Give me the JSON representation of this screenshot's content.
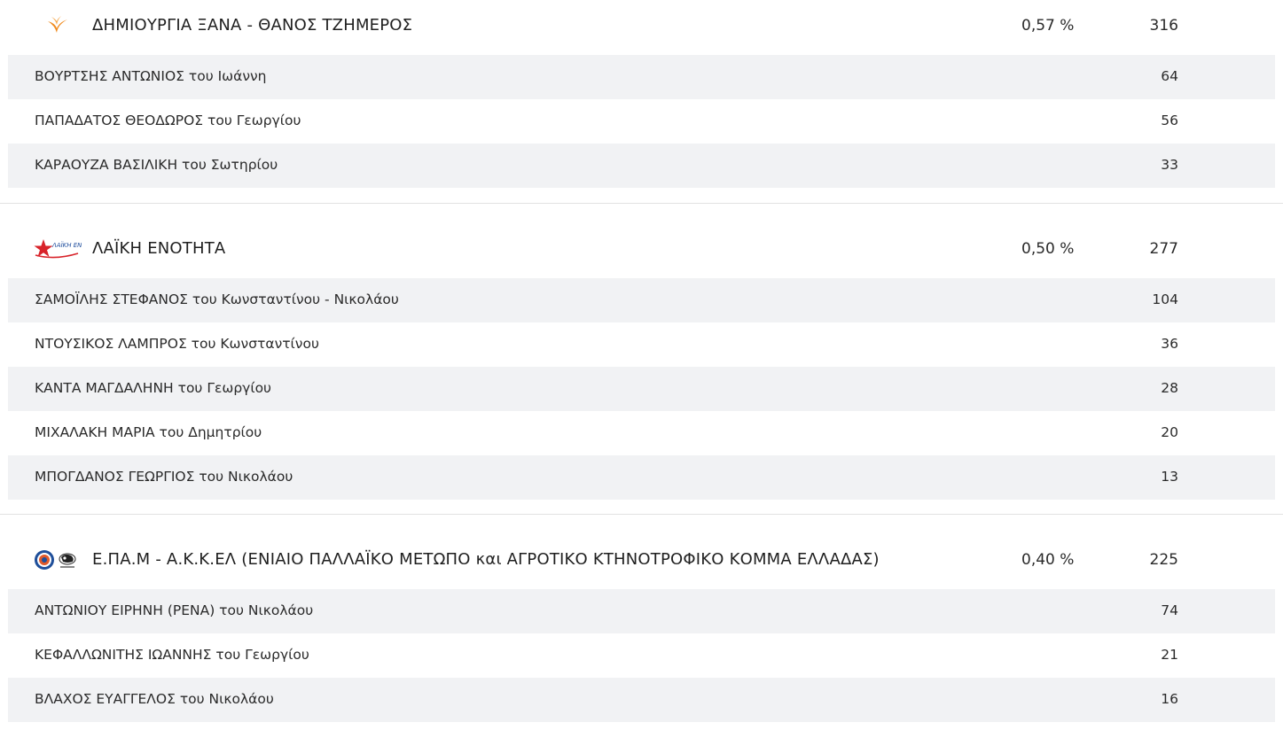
{
  "parties": [
    {
      "logo_icon": "dimiourgia-xana-logo-icon",
      "name": "ΔΗΜΙΟΥΡΓΙΑ ΞΑΝΑ - ΘΑΝΟΣ ΤΖΗΜΕΡΟΣ",
      "percent": "0,57 %",
      "votes": "316",
      "candidates": [
        {
          "name": "ΒΟΥΡΤΣΗΣ ΑΝΤΩΝΙΟΣ του Ιωάννη",
          "votes": "64"
        },
        {
          "name": "ΠΑΠΑΔΑΤΟΣ ΘΕΟΔΩΡΟΣ του Γεωργίου",
          "votes": "56"
        },
        {
          "name": "ΚΑΡΑΟΥΖΑ ΒΑΣΙΛΙΚΗ του Σωτηρίου",
          "votes": "33"
        }
      ]
    },
    {
      "logo_icon": "laiki-enotita-logo-icon",
      "logo_text": "ΛΑΪΚΗ ΕΝΟΤΗΤΑ",
      "name": "ΛΑΪΚΗ ΕΝΟΤΗΤΑ",
      "percent": "0,50 %",
      "votes": "277",
      "candidates": [
        {
          "name": "ΣΑΜΟΪΛΗΣ ΣΤΕΦΑΝΟΣ του Κωνσταντίνου - Νικολάου",
          "votes": "104"
        },
        {
          "name": "ΝΤΟΥΣΙΚΟΣ ΛΑΜΠΡΟΣ του Κωνσταντίνου",
          "votes": "36"
        },
        {
          "name": "ΚΑΝΤΑ ΜΑΓΔΑΛΗΝΗ του Γεωργίου",
          "votes": "28"
        },
        {
          "name": "ΜΙΧΑΛΑΚΗ ΜΑΡΙΑ του Δημητρίου",
          "votes": "20"
        },
        {
          "name": "ΜΠΟΓΔΑΝΟΣ ΓΕΩΡΓΙΟΣ του Νικολάου",
          "votes": "13"
        }
      ]
    },
    {
      "logo_icon": "epam-akkel-logo-icon",
      "name": "Ε.ΠΑ.Μ - Α.Κ.Κ.ΕΛ (ΕΝΙΑΙΟ ΠΑΛΛΑΪΚΟ ΜΕΤΩΠΟ και ΑΓΡΟΤΙΚΟ ΚΤΗΝΟΤΡΟΦΙΚΟ ΚΟΜΜΑ ΕΛΛΑΔΑΣ)",
      "percent": "0,40 %",
      "votes": "225",
      "candidates": [
        {
          "name": "ΑΝΤΩΝΙΟΥ ΕΙΡΗΝΗ (ΡΕΝΑ) του Νικολάου",
          "votes": "74"
        },
        {
          "name": "ΚΕΦΑΛΛΩΝΙΤΗΣ ΙΩΑΝΝΗΣ του Γεωργίου",
          "votes": "21"
        },
        {
          "name": "ΒΛΑΧΟΣ ΕΥΑΓΓΕΛΟΣ του Νικολάου",
          "votes": "16"
        }
      ]
    }
  ],
  "colors": {
    "row_shade": "#f1f2f4",
    "divider": "#e2e2e2",
    "dimiourgia_orange": "#f08a1c",
    "laiki_red": "#d8232a",
    "laiki_blue": "#1d4c9c",
    "epam_blue": "#1f4f9a"
  }
}
